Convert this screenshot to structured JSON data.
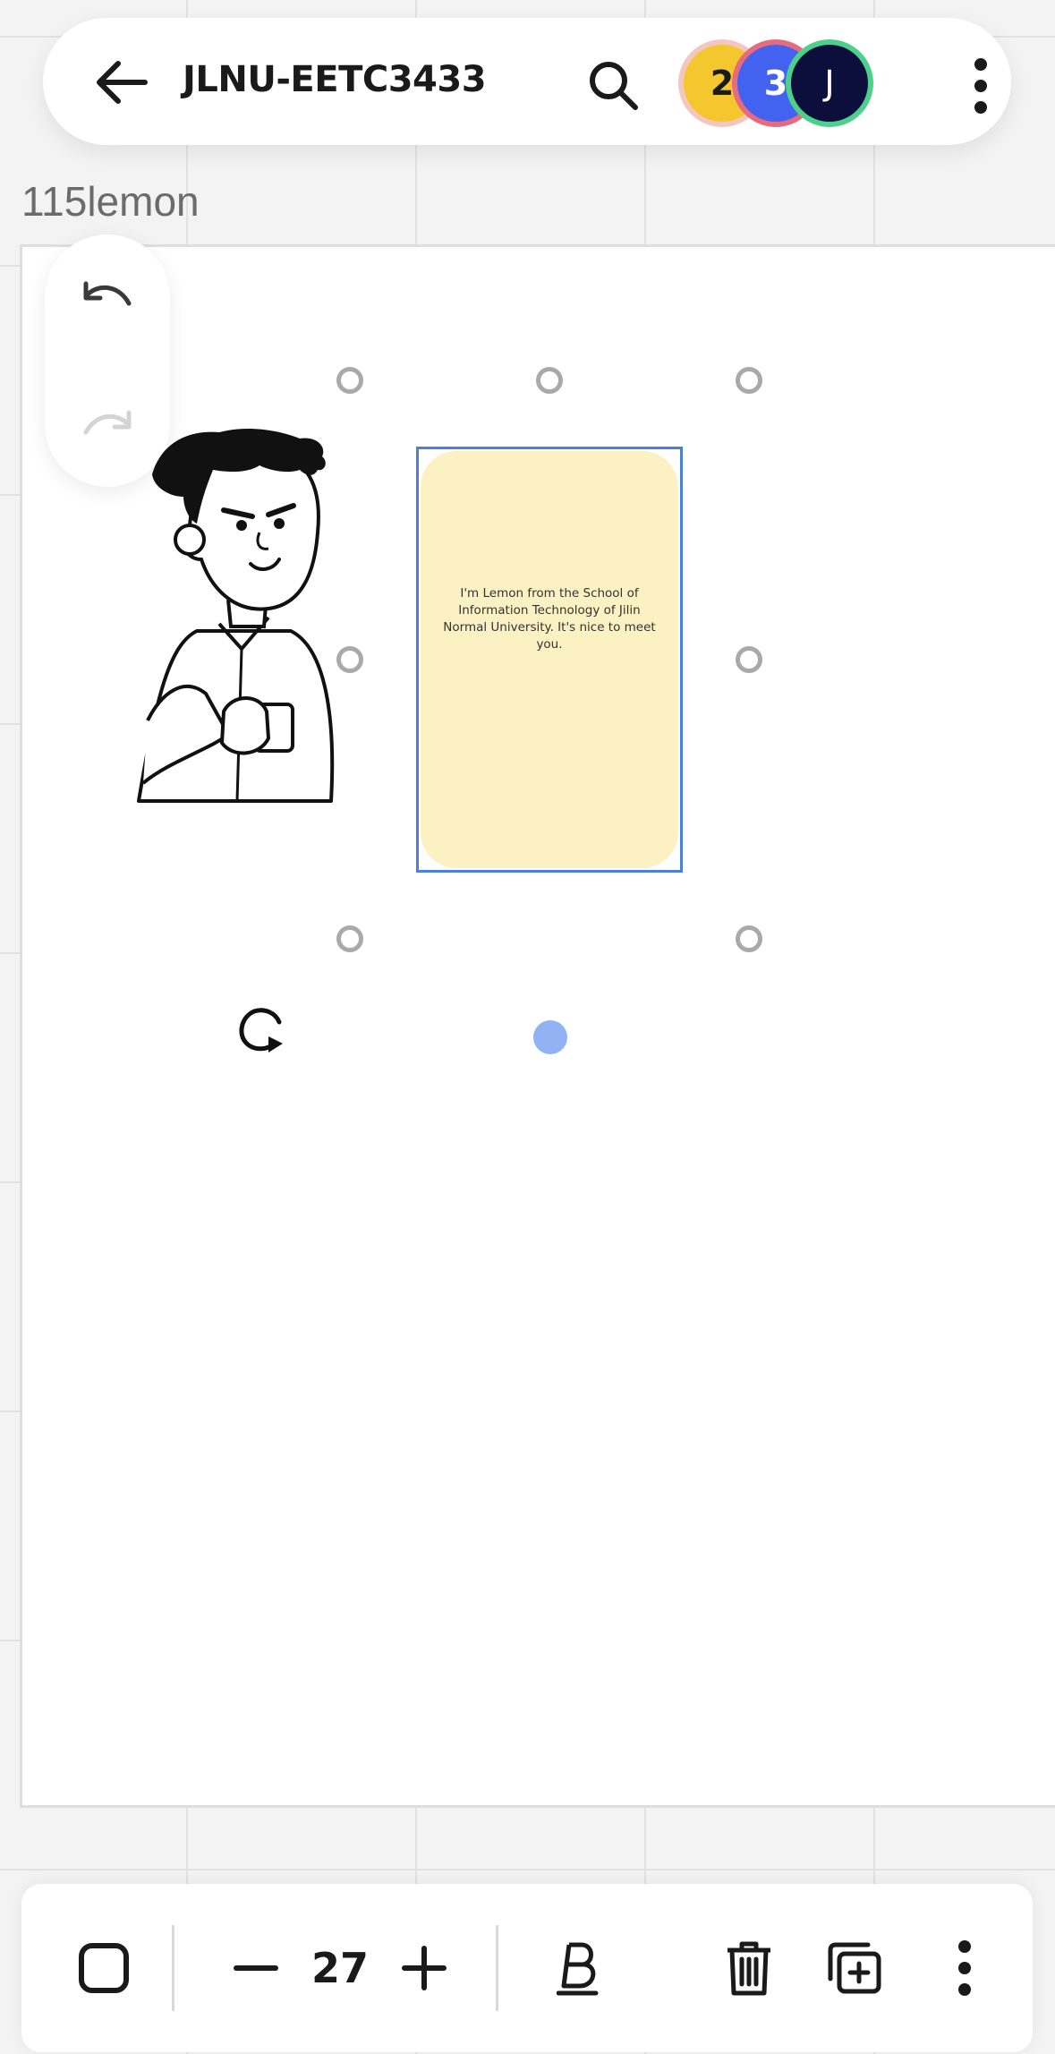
{
  "header": {
    "back_icon": "arrow-left-icon",
    "title": "JLNU-EETC3433",
    "search_icon": "search-icon",
    "collaborators": [
      {
        "initial": "2",
        "color": "#f5c72e",
        "ring": "#f4c6c0"
      },
      {
        "initial": "3",
        "color": "#4262ef",
        "ring": "#e86a7d"
      },
      {
        "initial": "J",
        "color": "#0c0f3c",
        "ring": "#4dd08c"
      }
    ],
    "more_icon": "more-vertical-icon"
  },
  "frame": {
    "label": "115lemon"
  },
  "history": {
    "undo_icon": "undo-icon",
    "redo_icon": "redo-icon"
  },
  "canvas": {
    "sticky_note": {
      "text": "I'm Lemon from the School of Information Technology of Jilin Normal University. It's nice to meet you.",
      "color": "#fbf1c2"
    },
    "illustration": "person-holding-cup-illustration"
  },
  "toolbar": {
    "shape_icon": "square-shape-icon",
    "decrease_icon": "minus-icon",
    "font_size": "27",
    "increase_icon": "plus-icon",
    "bold_icon": "bold-text-icon",
    "delete_icon": "trash-icon",
    "duplicate_icon": "duplicate-icon",
    "more_icon": "more-vertical-icon"
  },
  "colors": {
    "selection": "#4a80d9",
    "handle": "#a9a9a9",
    "connector": "#92b2f3"
  }
}
